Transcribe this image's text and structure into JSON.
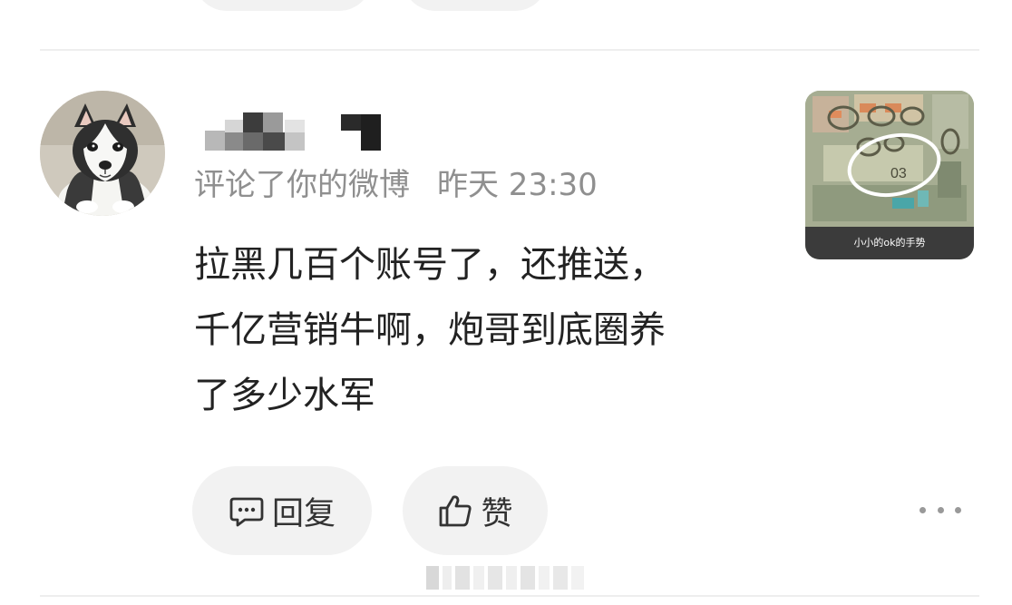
{
  "comment": {
    "action": "评论了你的微博",
    "time": "昨天 23:30",
    "content_lines": [
      "拉黑几百个账号了，还推送，",
      "千亿营销牛啊，炮哥到底圈养",
      "了多少水军"
    ],
    "thumbnail_caption": "小小的ok的手势",
    "thumbnail_mark": "03"
  },
  "actions": {
    "reply_label": "回复",
    "like_label": "赞"
  },
  "icons": {
    "reply": "comment-bubble-icon",
    "like": "thumbs-up-icon",
    "more": "more-dots-icon"
  },
  "colors": {
    "meta_text": "#8f8f8f",
    "content_text": "#222222",
    "button_bg": "#f2f2f2"
  }
}
